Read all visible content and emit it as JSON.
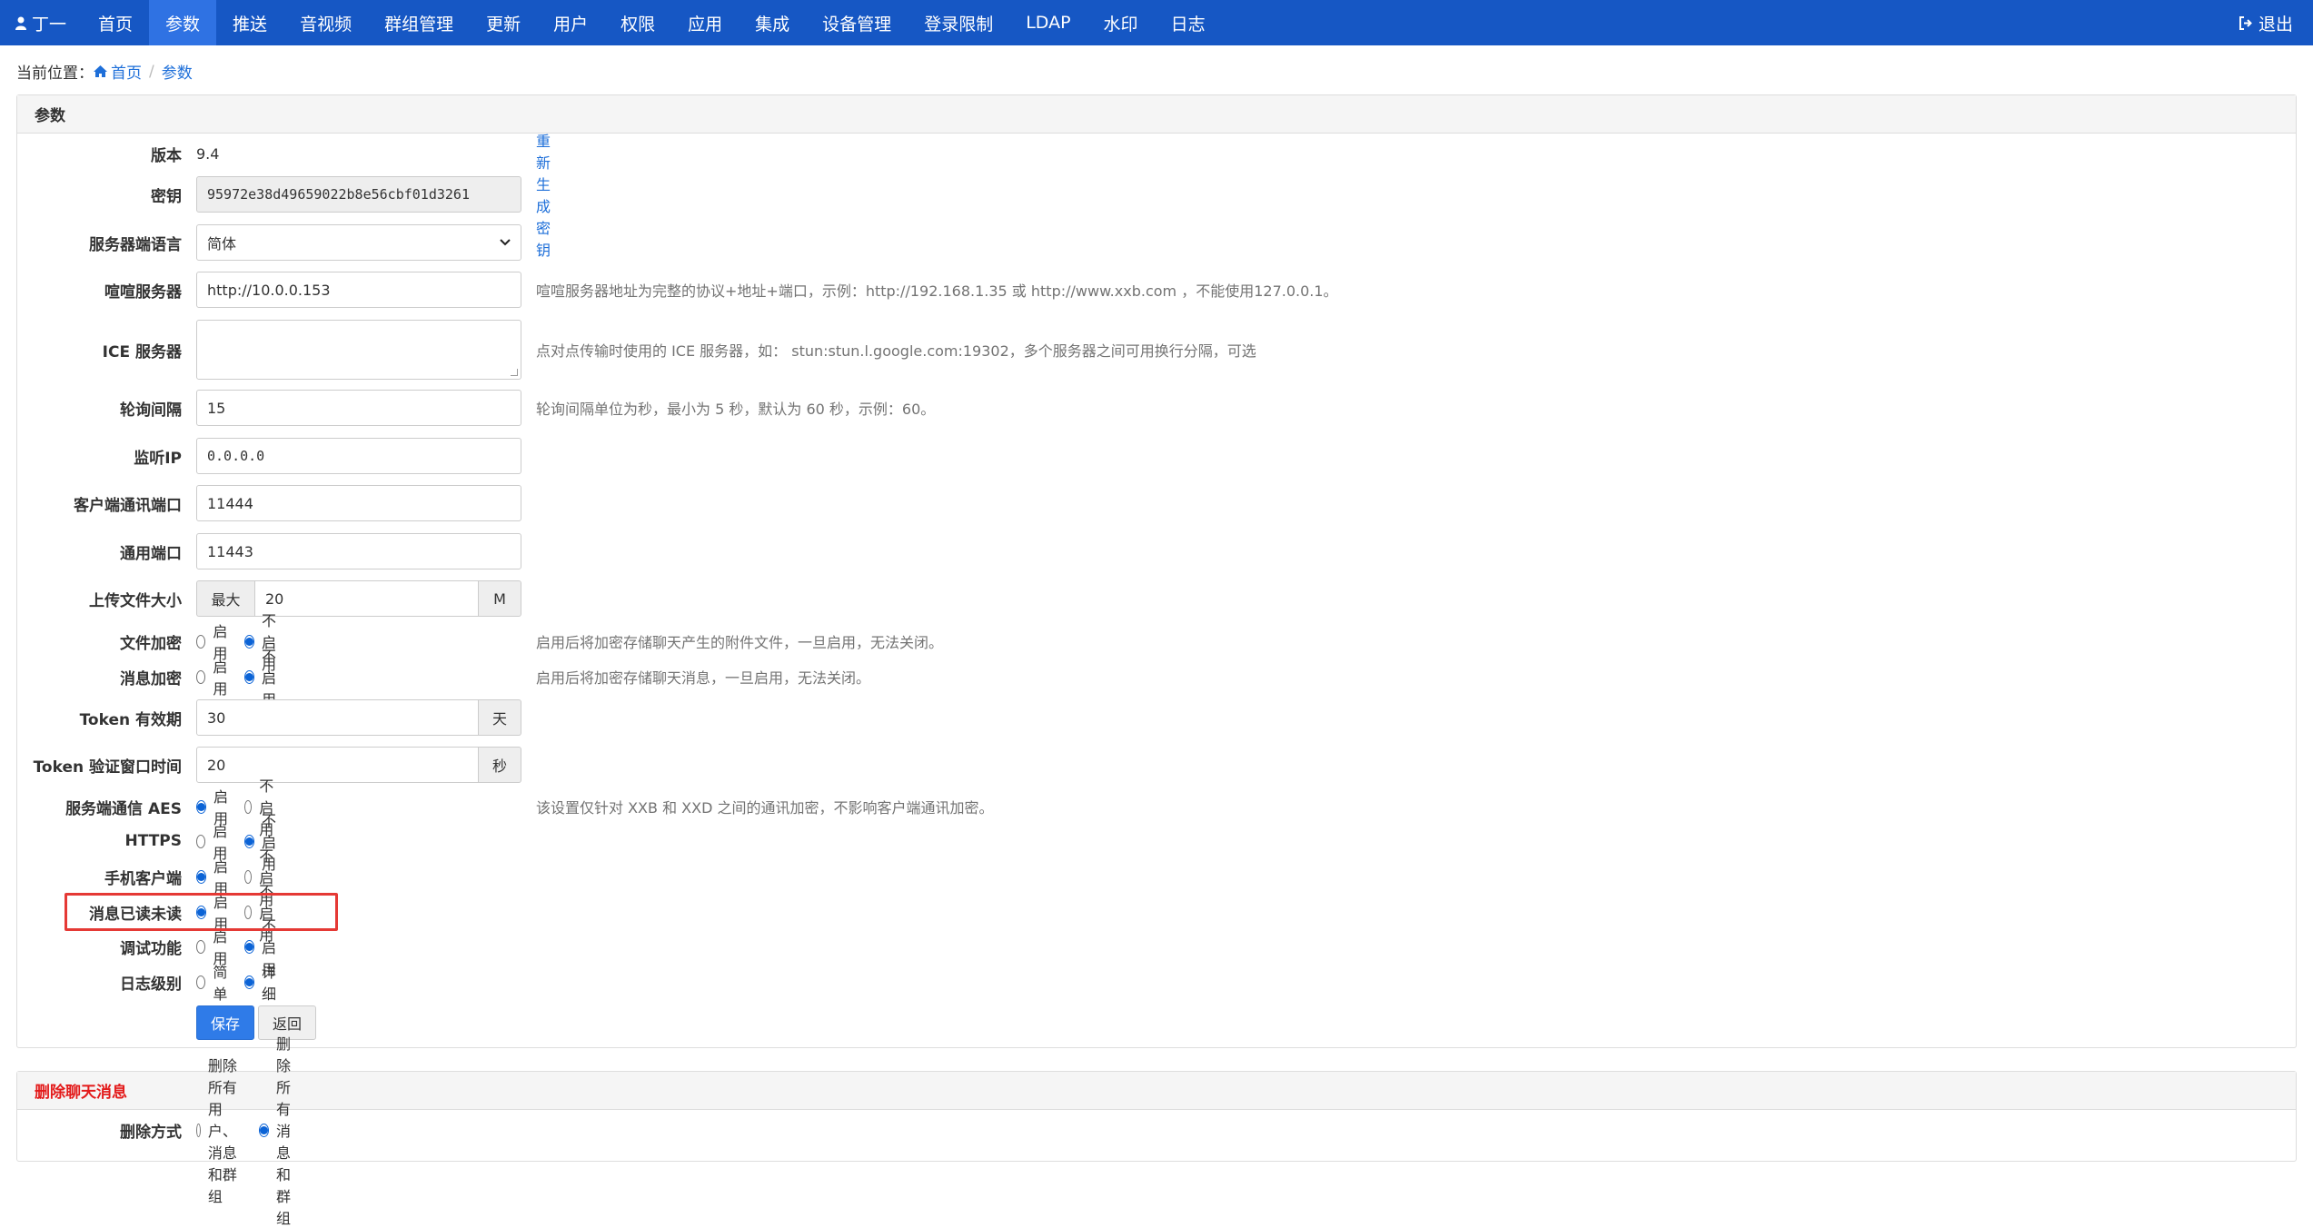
{
  "nav": {
    "user_name": "丁一",
    "items": [
      {
        "label": "首页",
        "active": false
      },
      {
        "label": "参数",
        "active": true
      },
      {
        "label": "推送",
        "active": false
      },
      {
        "label": "音视频",
        "active": false
      },
      {
        "label": "群组管理",
        "active": false
      },
      {
        "label": "更新",
        "active": false
      },
      {
        "label": "用户",
        "active": false
      },
      {
        "label": "权限",
        "active": false
      },
      {
        "label": "应用",
        "active": false
      },
      {
        "label": "集成",
        "active": false
      },
      {
        "label": "设备管理",
        "active": false
      },
      {
        "label": "登录限制",
        "active": false
      },
      {
        "label": "LDAP",
        "active": false
      },
      {
        "label": "水印",
        "active": false
      },
      {
        "label": "日志",
        "active": false
      }
    ],
    "logout_label": "退出"
  },
  "breadcrumb": {
    "prefix": "当前位置：",
    "home": "首页",
    "current": "参数"
  },
  "params_panel": {
    "title": "参数",
    "version_label": "版本",
    "version_value": "9.4",
    "key_label": "密钥",
    "key_value": "95972e38d49659022b8e56cbf01d3261",
    "key_regen": "重新生成密钥",
    "lang_label": "服务器端语言",
    "lang_value": "简体",
    "server_label": "喧喧服务器",
    "server_value": "http://10.0.0.153",
    "server_help": "喧喧服务器地址为完整的协议+地址+端口，示例：http://192.168.1.35 或 http://www.xxb.com ，不能使用127.0.0.1。",
    "ice_label": "ICE 服务器",
    "ice_value": "",
    "ice_help": "点对点传输时使用的 ICE 服务器，如： stun:stun.l.google.com:19302，多个服务器之间可用换行分隔，可选",
    "poll_label": "轮询间隔",
    "poll_value": "15",
    "poll_help": "轮询间隔单位为秒，最小为 5 秒，默认为 60 秒，示例：60。",
    "ip_label": "监听IP",
    "ip_value": "0.0.0.0",
    "client_port_label": "客户端通讯端口",
    "client_port_value": "11444",
    "common_port_label": "通用端口",
    "common_port_value": "11443",
    "upload_label": "上传文件大小",
    "upload_prefix": "最大",
    "upload_value": "20",
    "upload_suffix": "M",
    "file_enc_label": "文件加密",
    "file_enc_help": "启用后将加密存储聊天产生的附件文件，一旦启用，无法关闭。",
    "msg_enc_label": "消息加密",
    "msg_enc_help": "启用后将加密存储聊天消息，一旦启用，无法关闭。",
    "token_label": "Token 有效期",
    "token_value": "30",
    "token_suffix": "天",
    "token_window_label": "Token 验证窗口时间",
    "token_window_value": "20",
    "token_window_suffix": "秒",
    "aes_label": "服务端通信 AES",
    "aes_help": "该设置仅针对 XXB 和 XXD 之间的通讯加密，不影响客户端通讯加密。",
    "https_label": "HTTPS",
    "mobile_label": "手机客户端",
    "read_label": "消息已读未读",
    "debug_label": "调试功能",
    "log_label": "日志级别",
    "enable": "启用",
    "disable": "不启用",
    "log_simple": "简单",
    "log_detail": "详细",
    "save": "保存",
    "back": "返回"
  },
  "delete_panel": {
    "title": "删除聊天消息",
    "mode_label": "删除方式",
    "opt_all": "删除所有用户、消息和群组",
    "opt_msgs": "删除所有消息和群组"
  },
  "colors": {
    "navbar": "#1657c4",
    "nav_active": "#2f72e3",
    "link": "#1e6fd9",
    "danger": "#e31b1b",
    "highlight": "#e53935"
  }
}
